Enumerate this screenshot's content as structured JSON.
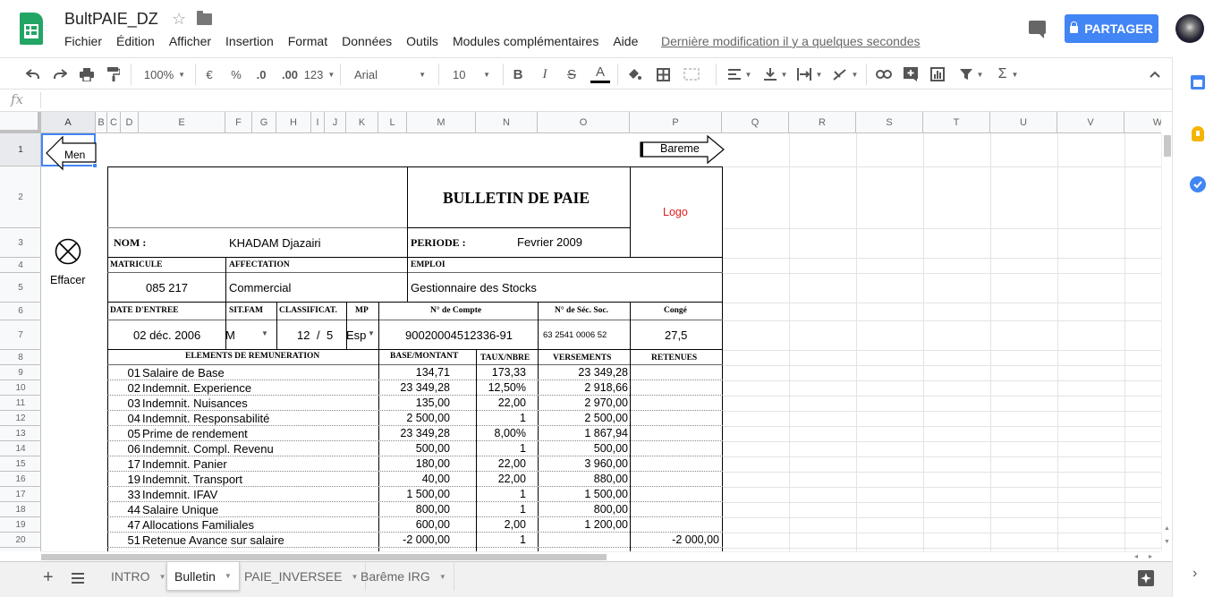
{
  "app": {
    "doc_title": "BultPAIE_DZ",
    "menu": [
      "Fichier",
      "Édition",
      "Afficher",
      "Insertion",
      "Format",
      "Données",
      "Outils",
      "Modules complémentaires",
      "Aide"
    ],
    "last_edit": "Dernière modification il y a quelques secondes",
    "share_label": "PARTAGER"
  },
  "toolbar": {
    "zoom": "100%",
    "currency": "€",
    "percent": "%",
    "dec_less": ".0",
    "dec_more": ".00",
    "more_formats": "123",
    "font": "Arial",
    "font_size": "10",
    "bold": "B",
    "italic": "I",
    "strike": "S",
    "text_color": "A"
  },
  "formula": {
    "fx": "fx",
    "value": ""
  },
  "columns": [
    "A",
    "B",
    "C",
    "D",
    "E",
    "F",
    "G",
    "H",
    "I",
    "J",
    "K",
    "L",
    "M",
    "N",
    "O",
    "P",
    "Q",
    "R",
    "S",
    "T",
    "U",
    "V",
    "W"
  ],
  "rows": [
    "1",
    "2",
    "3",
    "4",
    "5",
    "6",
    "7",
    "8",
    "9",
    "10",
    "11",
    "12",
    "13",
    "14",
    "15",
    "16",
    "17",
    "18",
    "19",
    "20"
  ],
  "sheet": {
    "menu_button": "Men",
    "bareme_button": "Bareme",
    "effacer": "Effacer",
    "title": "BULLETIN DE PAIE",
    "logo": "Logo",
    "nom_label": "NOM :",
    "nom_value": "KHADAM  Djazairi",
    "periode_label": "PERIODE  :",
    "periode_value": "Fevrier 2009",
    "h_matricule": "MATRICULE",
    "h_affectation": "AFFECTATION",
    "h_emploi": "EMPLOI",
    "matricule": "085 217",
    "affectation": "Commercial",
    "emploi": "Gestionnaire des Stocks",
    "h_date_entree": "DATE D'ENTREE",
    "h_sitfam": "SIT.FAM",
    "h_classif": "CLASSIFICAT.",
    "h_mp": "MP",
    "h_compte": "N° de Compte",
    "h_secsoc": "N° de Séc. Soc.",
    "h_conge": "Congé",
    "date_entree": "02 déc. 2006",
    "sitfam": "M",
    "classif_a": "12",
    "classif_sep": "/",
    "classif_b": "5",
    "mp": "Esp",
    "compte": "90020004512336-91",
    "secsoc": "63   2541   0006  52",
    "conge": "27,5",
    "h_elements": "ELEMENTS DE REMUNERATION",
    "h_base": "BASE/MONTANT",
    "h_taux": "TAUX/NBRE",
    "h_versements": "VERSEMENTS",
    "h_retenues": "RETENUES",
    "lines": [
      {
        "code": "01",
        "label": "Salaire de Base",
        "base": "134,71",
        "taux": "173,33",
        "vers": "23 349,28",
        "ret": ""
      },
      {
        "code": "02",
        "label": "Indemnit. Experience",
        "base": "23 349,28",
        "taux": "12,50%",
        "vers": "2 918,66",
        "ret": ""
      },
      {
        "code": "03",
        "label": "Indemnit. Nuisances",
        "base": "135,00",
        "taux": "22,00",
        "vers": "2 970,00",
        "ret": ""
      },
      {
        "code": "04",
        "label": "Indemnit. Responsabilité",
        "base": "2 500,00",
        "taux": "1",
        "vers": "2 500,00",
        "ret": ""
      },
      {
        "code": "05",
        "label": "Prime de rendement",
        "base": "23 349,28",
        "taux": "8,00%",
        "vers": "1 867,94",
        "ret": ""
      },
      {
        "code": "06",
        "label": "Indemnit. Compl. Revenu",
        "base": "500,00",
        "taux": "1",
        "vers": "500,00",
        "ret": ""
      },
      {
        "code": "17",
        "label": "Indemnit. Panier",
        "base": "180,00",
        "taux": "22,00",
        "vers": "3 960,00",
        "ret": ""
      },
      {
        "code": "19",
        "label": "Indemnit. Transport",
        "base": "40,00",
        "taux": "22,00",
        "vers": "880,00",
        "ret": ""
      },
      {
        "code": "33",
        "label": "Indemnit. IFAV",
        "base": "1 500,00",
        "taux": "1",
        "vers": "1 500,00",
        "ret": ""
      },
      {
        "code": "44",
        "label": "Salaire Unique",
        "base": "800,00",
        "taux": "1",
        "vers": "800,00",
        "ret": ""
      },
      {
        "code": "47",
        "label": "Allocations Familiales",
        "base": "600,00",
        "taux": "2,00",
        "vers": "1 200,00",
        "ret": ""
      },
      {
        "code": "51",
        "label": "Retenue Avance sur salaire",
        "base": "-2 000,00",
        "taux": "1",
        "vers": "",
        "ret": "-2 000,00"
      }
    ]
  },
  "tabs": [
    "INTRO",
    "Bulletin",
    "PAIE_INVERSEE",
    "Barême IRG"
  ],
  "active_tab": "Bulletin"
}
